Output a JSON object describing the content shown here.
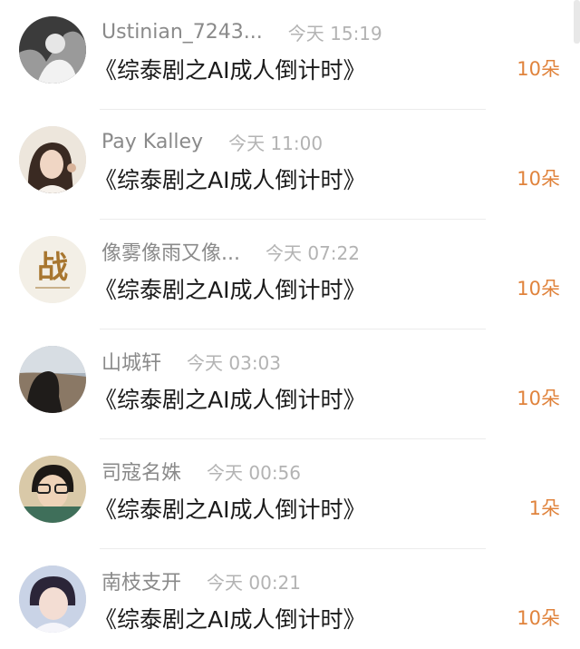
{
  "feed": {
    "items": [
      {
        "name": "Ustinian_7243...",
        "time": "今天 15:19",
        "title": "《综泰剧之AI成人倒计时》",
        "gift": "10朵"
      },
      {
        "name": "Pay Kalley",
        "time": "今天 11:00",
        "title": "《综泰剧之AI成人倒计时》",
        "gift": "10朵"
      },
      {
        "name": "像雾像雨又像...",
        "time": "今天 07:22",
        "title": "《综泰剧之AI成人倒计时》",
        "gift": "10朵",
        "avatar_text": "战"
      },
      {
        "name": "山城轩",
        "time": "今天 03:03",
        "title": "《综泰剧之AI成人倒计时》",
        "gift": "10朵"
      },
      {
        "name": "司寇名姝",
        "time": "今天 00:56",
        "title": "《综泰剧之AI成人倒计时》",
        "gift": "1朵"
      },
      {
        "name": "南枝支开",
        "time": "今天 00:21",
        "title": "《综泰剧之AI成人倒计时》",
        "gift": "10朵"
      }
    ]
  },
  "colors": {
    "gift": "#e0833c",
    "name": "#8a8a8a",
    "time": "#b3b3b3",
    "title": "#1a1a1a"
  }
}
